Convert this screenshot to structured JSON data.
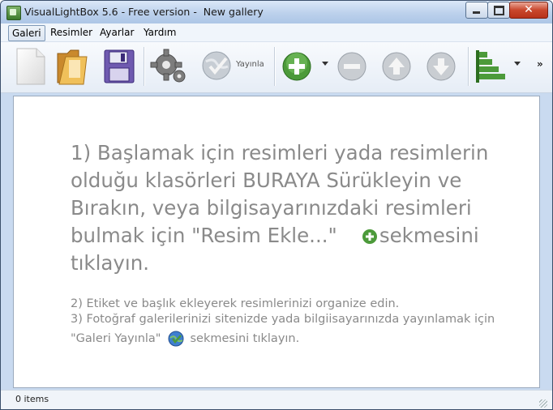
{
  "window": {
    "title": "VisualLightBox 5.6 - Free version -  New gallery"
  },
  "menu": {
    "items": [
      {
        "label": "Galeri"
      },
      {
        "label": "Resimler"
      },
      {
        "label": "Ayarlar"
      },
      {
        "label": "Yardım"
      }
    ]
  },
  "toolbar": {
    "publish_label": "Yayınla",
    "icons": [
      "new-document-icon",
      "open-folder-icon",
      "save-disk-icon",
      "settings-gear-icon",
      "publish-globe-icon",
      "add-plus-icon",
      "remove-minus-icon",
      "move-up-icon",
      "move-down-icon",
      "view-bars-icon"
    ],
    "more": "»"
  },
  "content": {
    "lead_text": "1) Başlamak için resimleri yada resimlerin olduğu klasörleri BURAYA Sürükleyin ve Bırakın, veya bilgisayarınızdaki resimleri bulmak için \"Resim Ekle...\"",
    "lead_suffix": "sekmesini tıklayın.",
    "line2": "2) Etiket ve başlık ekleyerek resimlerinizi organize edin.",
    "line3a": "3) Fotoğraf galerilerinizi sitenizde yada bilgiisayarınızda yayınlamak için",
    "line3b": "\"Galeri Yayınla\"",
    "line3c": "sekmesini tıklayın."
  },
  "status": {
    "items": "0 items"
  },
  "colors": {
    "accent_green": "#4c9a3a",
    "text_gray": "#8a8a8a",
    "title_bar": "#bcd1ec"
  }
}
